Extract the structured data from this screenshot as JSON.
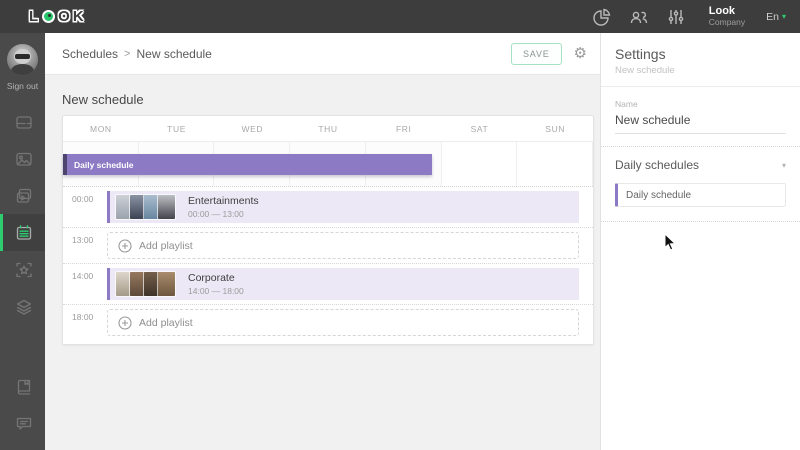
{
  "colors": {
    "accent_green": "#2ecc71",
    "logo_green": "#27c46a",
    "purple": "#8d7ac4",
    "purple_row_bg": "#ece8f6",
    "topbar_bg": "#3d3d3d",
    "sidebar_bg": "#4a4a4a",
    "main_bg": "#f1f1f2"
  },
  "topbar": {
    "logo_text": "LOOK",
    "account": {
      "name": "Look",
      "type": "Company"
    },
    "language": {
      "label": "En",
      "caret": "▾"
    }
  },
  "sidebar": {
    "sign_out_label": "Sign out",
    "items": [
      {
        "id": "screens",
        "icon": "screens-icon",
        "active": false
      },
      {
        "id": "media",
        "icon": "images-icon",
        "active": false
      },
      {
        "id": "playlists",
        "icon": "video-playlist-icon",
        "active": false
      },
      {
        "id": "schedules",
        "icon": "calendar-icon",
        "active": true
      },
      {
        "id": "apps",
        "icon": "star-frame-icon",
        "active": false
      },
      {
        "id": "layers",
        "icon": "layers-icon",
        "active": false
      }
    ],
    "bottom_items": [
      {
        "id": "docs",
        "icon": "book-icon"
      },
      {
        "id": "feedback",
        "icon": "chat-icon"
      }
    ]
  },
  "breadcrumb": {
    "root": "Schedules",
    "separator": ">",
    "current": "New schedule"
  },
  "toolbar": {
    "save_label": "SAVE"
  },
  "schedule": {
    "title": "New schedule",
    "days": [
      "MON",
      "TUE",
      "WED",
      "THU",
      "FRI",
      "SAT",
      "SUN"
    ],
    "week_bar": {
      "label": "Daily schedule",
      "start_day": 0,
      "span_days": 5
    },
    "timeline": [
      {
        "time": "00:00",
        "type": "playlist",
        "name": "Entertainments",
        "range": "00:00 — 13:00",
        "thumbs": [
          [
            "#cdd1d7",
            "#9aa2ac"
          ],
          [
            "#8a93a4",
            "#3c4354"
          ],
          [
            "#aabdce",
            "#67869f"
          ],
          [
            "#bcbfc5",
            "#45454c"
          ]
        ]
      },
      {
        "time": "13:00",
        "type": "add",
        "label": "Add playlist"
      },
      {
        "time": "14:00",
        "type": "playlist",
        "name": "Corporate",
        "range": "14:00 — 18:00",
        "thumbs": [
          [
            "#ddd6cb",
            "#a59a88"
          ],
          [
            "#96785f",
            "#5d4a39"
          ],
          [
            "#75604c",
            "#3e3329"
          ],
          [
            "#a98c6d",
            "#6e573f"
          ]
        ]
      },
      {
        "time": "18:00",
        "type": "add",
        "label": "Add playlist"
      }
    ]
  },
  "settings": {
    "title": "Settings",
    "subtitle": "New schedule",
    "name_label": "Name",
    "name_value": "New schedule",
    "daily_schedules": {
      "label": "Daily schedules",
      "collapse_caret": "▾",
      "items": [
        {
          "label": "Daily schedule"
        }
      ]
    }
  }
}
